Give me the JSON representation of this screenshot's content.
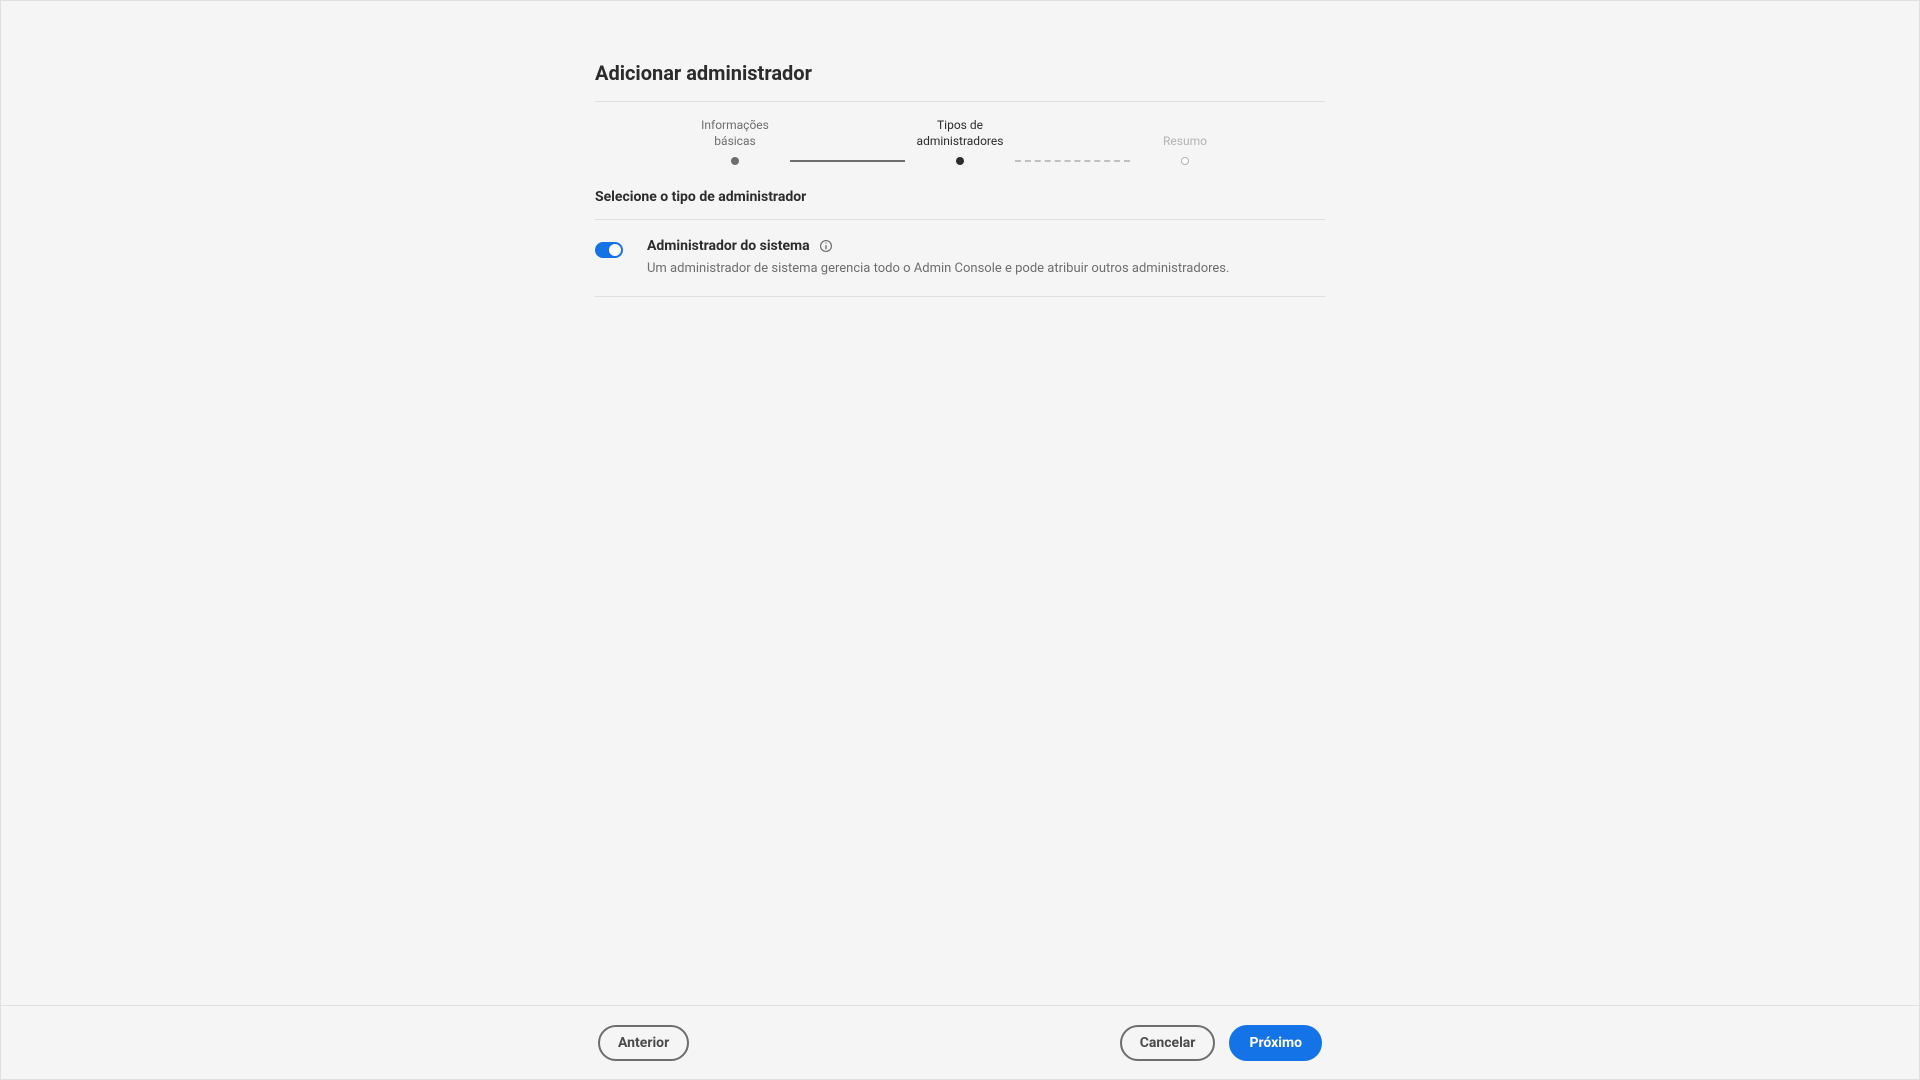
{
  "page": {
    "title": "Adicionar administrador"
  },
  "stepper": {
    "steps": [
      {
        "label": "Informações básicas"
      },
      {
        "label": "Tipos de\nadministradores"
      },
      {
        "label": "Resumo"
      }
    ]
  },
  "section": {
    "title": "Selecione o tipo de administrador"
  },
  "admin_type": {
    "title": "Administrador do sistema",
    "description": "Um administrador de sistema gerencia todo o Admin Console e pode atribuir outros administradores."
  },
  "footer": {
    "previous": "Anterior",
    "cancel": "Cancelar",
    "next": "Próximo"
  }
}
